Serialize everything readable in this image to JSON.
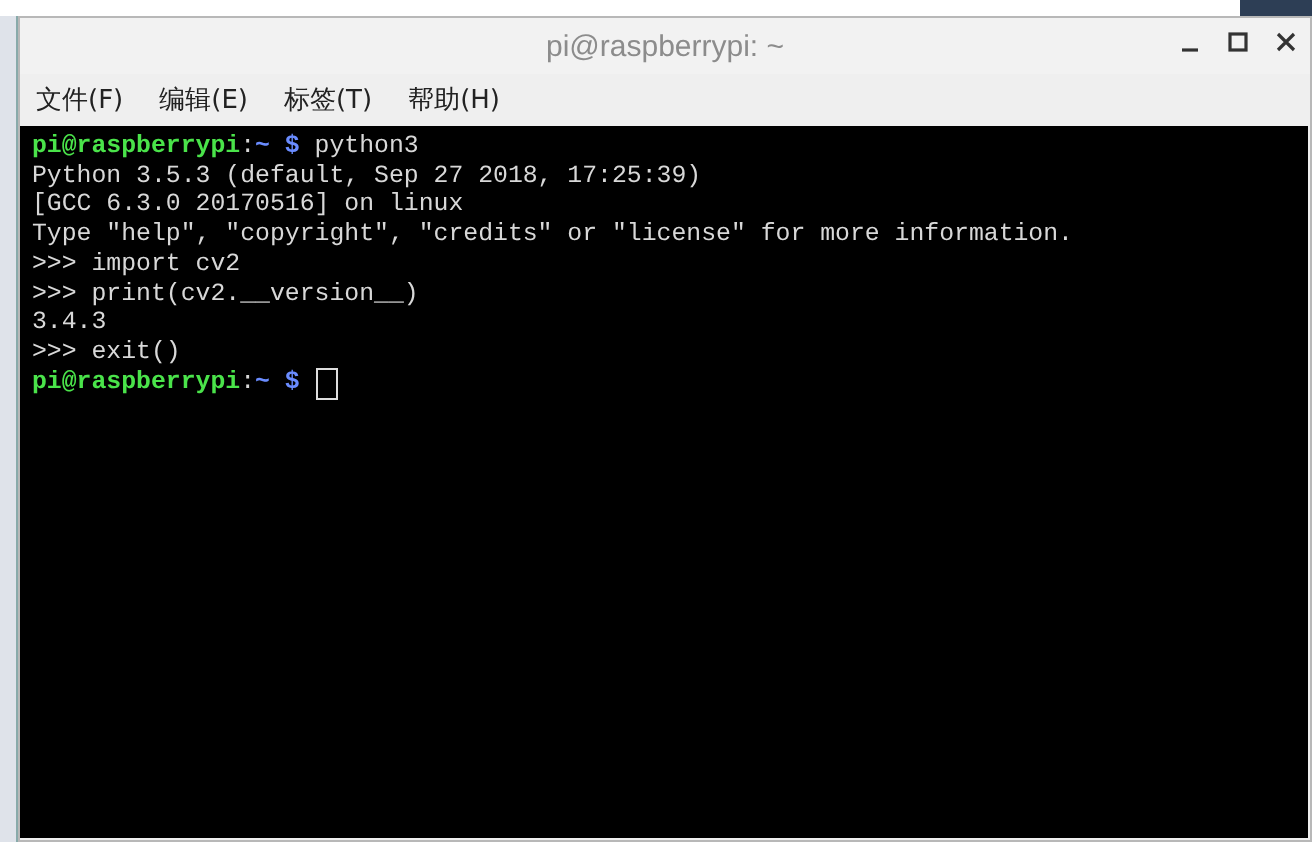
{
  "window": {
    "title": "pi@raspberrypi: ~",
    "controls": [
      {
        "kind": "minimize"
      },
      {
        "kind": "maximize"
      },
      {
        "kind": "close"
      }
    ]
  },
  "menu": [
    {
      "label": "文件(F)"
    },
    {
      "label": "编辑(E)"
    },
    {
      "label": "标签(T)"
    },
    {
      "label": "帮助(H)"
    }
  ],
  "terminal": {
    "lines": [
      {
        "segments": [
          {
            "kind": "user",
            "text": "pi@raspberrypi"
          },
          {
            "kind": "plain",
            "text": ":"
          },
          {
            "kind": "path",
            "text": "~ $"
          },
          {
            "kind": "plain",
            "text": " python3"
          }
        ]
      },
      {
        "segments": [
          {
            "kind": "plain",
            "text": "Python 3.5.3 (default, Sep 27 2018, 17:25:39)"
          }
        ]
      },
      {
        "segments": [
          {
            "kind": "plain",
            "text": "[GCC 6.3.0 20170516] on linux"
          }
        ]
      },
      {
        "segments": [
          {
            "kind": "plain",
            "text": "Type \"help\", \"copyright\", \"credits\" or \"license\" for more information."
          }
        ]
      },
      {
        "segments": [
          {
            "kind": "plain",
            "text": ">>> import cv2"
          }
        ]
      },
      {
        "segments": [
          {
            "kind": "plain",
            "text": ">>> print(cv2.__version__)"
          }
        ]
      },
      {
        "segments": [
          {
            "kind": "plain",
            "text": "3.4.3"
          }
        ]
      },
      {
        "segments": [
          {
            "kind": "plain",
            "text": ">>> exit()"
          }
        ]
      },
      {
        "segments": [
          {
            "kind": "user",
            "text": "pi@raspberrypi"
          },
          {
            "kind": "plain",
            "text": ":"
          },
          {
            "kind": "path",
            "text": "~ $"
          }
        ],
        "cursor": true
      }
    ]
  }
}
